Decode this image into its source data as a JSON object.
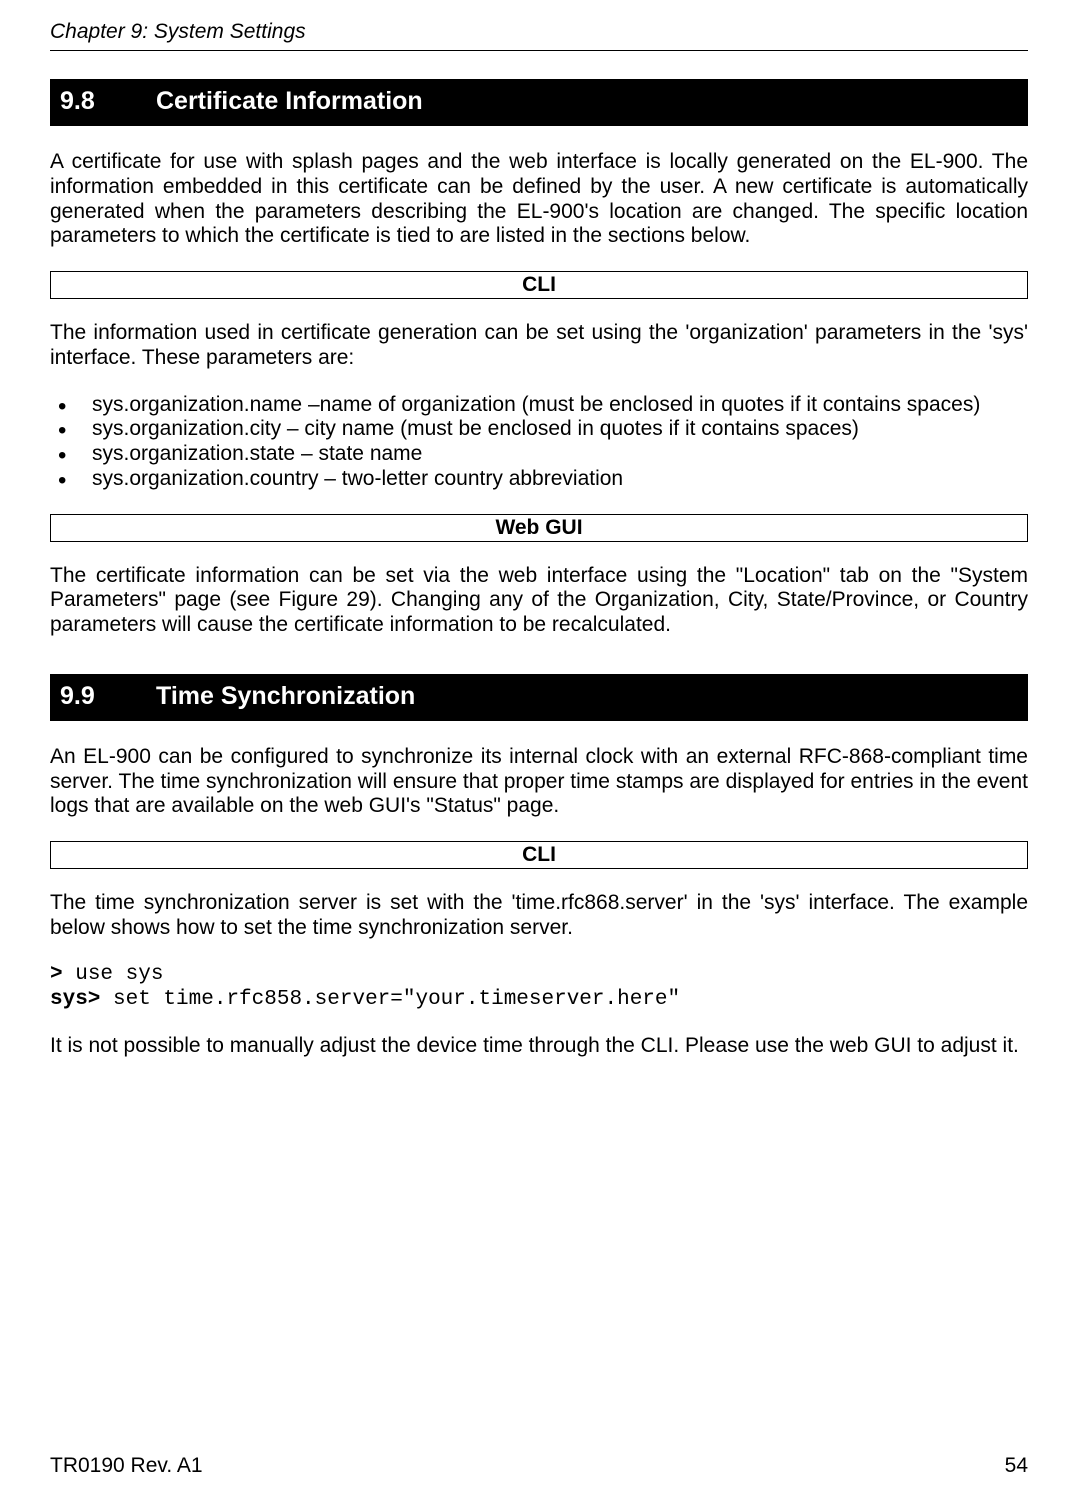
{
  "header": {
    "chapter": "Chapter 9: System Settings"
  },
  "section1": {
    "number": "9.8",
    "title": "Certificate Information",
    "intro": "A certificate for use with splash pages and the web interface is locally generated on the EL-900. The information embedded in this certificate can be defined by the user. A new certificate is automatically generated when the parameters describing the EL-900's location are changed. The specific location parameters to which the certificate is tied to are listed in the sections below.",
    "cli_heading": "CLI",
    "cli_intro": "The information used in certificate generation can be set using the 'organization' parameters in the 'sys' interface. These parameters are:",
    "bullets": [
      "sys.organization.name –name of organization (must be enclosed in quotes if it contains spaces)",
      "sys.organization.city – city name (must be enclosed in quotes if it contains spaces)",
      "sys.organization.state – state name",
      "sys.organization.country – two-letter country abbreviation"
    ],
    "webgui_heading": "Web GUI",
    "webgui_text": "The certificate information can be set via the web interface using the \"Location\" tab on the \"System Parameters\" page (see Figure 29). Changing any of the Organization, City, State/Province, or Country parameters will cause the certificate information to be recalculated."
  },
  "section2": {
    "number": "9.9",
    "title": "Time Synchronization",
    "intro": "An EL-900 can be configured to synchronize its internal clock with an external RFC-868-compliant time server. The time synchronization will ensure that proper time stamps are displayed for entries in the event logs that are available on the web GUI's \"Status\" page.",
    "cli_heading": "CLI",
    "cli_intro": "The time synchronization server is set with the 'time.rfc868.server' in the 'sys' interface. The example below shows how to set the time synchronization server.",
    "code": {
      "line1_prompt": ">",
      "line1_cmd": " use sys",
      "line2_prompt": "sys>",
      "line2_cmd": " set time.rfc858.server=\"your.timeserver.here\""
    },
    "cli_note": "It is not possible to manually adjust the device time through the CLI. Please use the web GUI to adjust it."
  },
  "footer": {
    "left": "TR0190 Rev. A1",
    "right": "54"
  }
}
